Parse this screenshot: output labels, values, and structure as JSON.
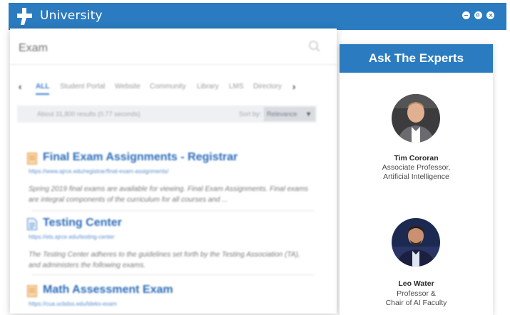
{
  "app": {
    "title": "University",
    "brand_color": "#2a7bbf"
  },
  "search": {
    "query": "Exam",
    "placeholder": "Search"
  },
  "tabs": [
    "ALL",
    "Student Portal",
    "Website",
    "Community",
    "Library",
    "LMS",
    "Directory"
  ],
  "results_bar": {
    "count_text": "About 31,800 results (0.77 seconds)",
    "sort_label": "Sort by:",
    "sort_value": "Relevance"
  },
  "results": [
    {
      "title": "Final Exam Assignments - Registrar",
      "url": "https://www.ajrce.edu/registrar/final-exam-assignments/",
      "snippet": "Spring 2019 final exams are available for viewing. Final Exam Assignments. Final exams are integral components of the curriculum for all courses and ...",
      "icon": "folder-icon"
    },
    {
      "title": "Testing Center",
      "url": "https://ets.ajrce.edu/testing-center",
      "snippet": "The Testing Center adheres to the guidelines set forth by the Testing Association (TA), and administers the following exams.",
      "icon": "document-icon"
    },
    {
      "title": "Math Assessment Exam",
      "url": "https://cua.ucbdss.edu/ldeko-exam",
      "snippet": "",
      "icon": "folder-icon"
    }
  ],
  "experts": {
    "heading": "Ask The Experts",
    "people": [
      {
        "name": "Tim Cororan",
        "role_line1": "Associate Professor,",
        "role_line2": "Artificial Intelligence"
      },
      {
        "name": "Leo Water",
        "role_line1": "Professor &",
        "role_line2": "Chair of AI Faculty"
      }
    ]
  }
}
